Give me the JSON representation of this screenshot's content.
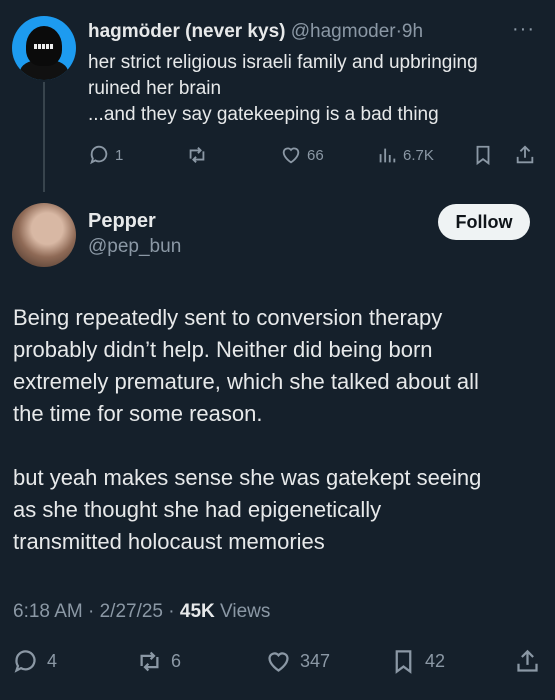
{
  "parent_tweet": {
    "author_name": "hagmöder (never kys)",
    "author_handle": "@hagmoder",
    "separator": "·",
    "time": "9h",
    "more": "···",
    "text_lines": [
      "her strict religious israeli family and upbringing",
      "ruined her brain",
      "...and they say gatekeeping is a bad thing"
    ],
    "replies": "1",
    "likes": "66",
    "views": "6.7K",
    "avatar_color": "#1d9bf0"
  },
  "main_tweet": {
    "author_name": "Pepper",
    "author_handle": "@pep_bun",
    "follow_label": "Follow",
    "text_lines": [
      "Being repeatedly sent to conversion therapy",
      "probably didn’t help. Neither did being born",
      "extremely premature, which she talked about all",
      "the time for some reason.",
      "",
      "but yeah makes sense she was gatekept seeing",
      "as she thought she had epigenetically",
      "transmitted holocaust memories"
    ],
    "time": "6:18 AM",
    "date": "2/27/25",
    "views_count": "45K",
    "views_label": "Views",
    "replies": "4",
    "retweets": "6",
    "likes": "347",
    "bookmarks": "42"
  },
  "colors": {
    "background": "#15202b",
    "text": "#e7e9ea",
    "secondary": "#8b98a5",
    "follow_bg": "#eff3f4"
  }
}
